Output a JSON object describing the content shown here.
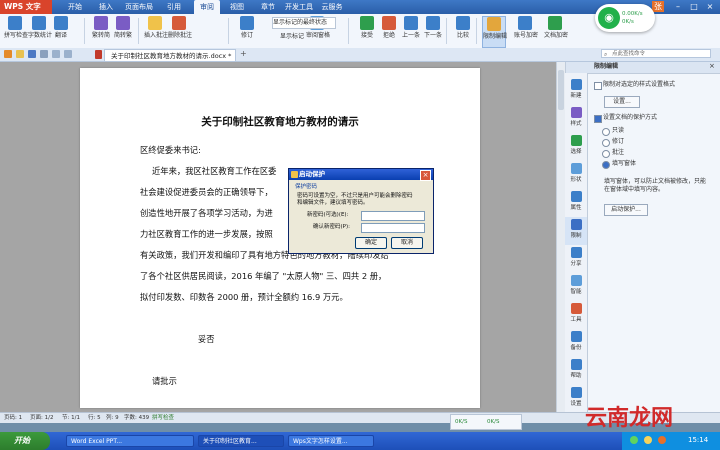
{
  "app": {
    "name": "WPS 文字"
  },
  "menu": {
    "tabs": [
      "开始",
      "插入",
      "页面布局",
      "引用",
      "审阅",
      "视图",
      "章节",
      "开发工具",
      "云服务"
    ],
    "active": "审阅"
  },
  "window_controls": {
    "user": "张",
    "minimize": "–",
    "maximize": "□",
    "close": "×"
  },
  "ribbon": {
    "buttons": [
      "拼写检查",
      "字数统计",
      "翻译",
      "繁转简",
      "简转繁",
      "插入批注",
      "删除批注",
      "修订",
      "审阅窗格",
      "接受",
      "拒绝",
      "上一条",
      "下一条",
      "比较",
      "限制编辑",
      "账号加密",
      "文档加密"
    ],
    "display_markup": "显示标记的最终状态",
    "show_markup": "显示标记"
  },
  "wifi": {
    "download": "0.00K/s",
    "upload": "0K/s"
  },
  "tabs": {
    "document": "关于印制社区教育地方教材的请示.docx *",
    "new_tab": "+"
  },
  "search": {
    "placeholder": "点此查找命令"
  },
  "document": {
    "title": "关于印制社区教育地方教材的请示",
    "salutation": "区终促委来书记:",
    "lines": [
      "近年来，我区社区教育工作在区委",
      "社会建设促进委员会的正确领导下，",
      "创造性地开展了各项学习活动，为进",
      "力社区教育工作的进一步发展，按照",
      "有关政策，我们开发和编印了具有地方特色的地方教材，陆续印发给",
      "了各个社区供居民阅读，2016 年编了 \"太原人物\" 三、四共 2 册，",
      "拟付印发数、印数各 2000 册，预计全额约 16.9 万元。"
    ],
    "signature": "妥否",
    "closing": "请批示"
  },
  "dialog": {
    "title": "启动保护",
    "section": "保护密码",
    "description_1": "密码可设置为空，不过只是用户可能会删除密码",
    "description_2": "和编辑文件，建议填写密码。",
    "new_password_label": "新密码(可选)(E):",
    "confirm_password_label": "确认新密码(P):",
    "ok": "确定",
    "cancel": "取消",
    "close": "×"
  },
  "panel": {
    "title": "限制编辑",
    "option_format": "限制对选定的样式设置格式",
    "settings_button": "设置...",
    "option_editing": "设置文档的保护方式",
    "radios": [
      "只读",
      "修订",
      "批注",
      "填写窗体"
    ],
    "selected": "填写窗体",
    "hint_1": "填写窗体，可以防止文档被修改，只能",
    "hint_2": "在窗体域中填写内容。",
    "start_button": "启动保护..."
  },
  "sidebar_icons": [
    "新建",
    "样式",
    "选择",
    "形状",
    "属性",
    "限制",
    "分享",
    "智能",
    "工具",
    "备份",
    "帮助",
    "设置"
  ],
  "status": {
    "page_count": "页码: 1",
    "pages": "页面: 1/2",
    "section": "节: 1/1",
    "row": "行: 5",
    "col": "列: 9",
    "words": "字数: 439",
    "spell": "拼写检查",
    "speed_down": "0K/S",
    "speed_up": "0K/S"
  },
  "taskbar": {
    "start": "开始",
    "tasks": [
      "Word Excel PPT...",
      "关于印制社区教育...",
      "Wps文字怎样设置..."
    ],
    "time": "15:14"
  },
  "watermark": "云南龙网",
  "colors": {
    "ribbon": "#f2f6fc",
    "menubar": "#2a5ea8",
    "appbtn": "#d9442b",
    "dialog_title": "#0a3fb0",
    "taskbar": "#1d4fb8"
  }
}
